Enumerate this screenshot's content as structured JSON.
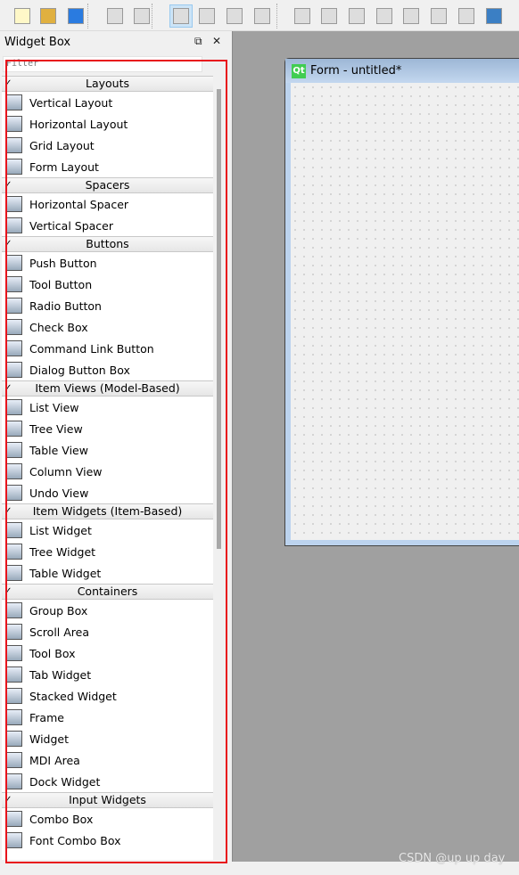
{
  "toolbar": {
    "buttons": [
      "new-file-icon",
      "open-folder-icon",
      "save-icon",
      "send-backward-icon",
      "bring-forward-icon",
      "edit-widgets-icon",
      "edit-signals-slots-icon",
      "edit-buddies-icon",
      "edit-tab-order-icon",
      "layout-horizontal-icon",
      "layout-vertical-icon",
      "splitter-horizontal-icon",
      "splitter-vertical-icon",
      "layout-grid-icon",
      "layout-form-icon",
      "break-layout-icon",
      "adjust-size-icon"
    ]
  },
  "widget_box": {
    "title": "Widget Box",
    "filter_placeholder": "Filter",
    "categories": [
      {
        "label": "Layouts",
        "items": [
          "Vertical Layout",
          "Horizontal Layout",
          "Grid Layout",
          "Form Layout"
        ]
      },
      {
        "label": "Spacers",
        "items": [
          "Horizontal Spacer",
          "Vertical Spacer"
        ]
      },
      {
        "label": "Buttons",
        "items": [
          "Push Button",
          "Tool Button",
          "Radio Button",
          "Check Box",
          "Command Link Button",
          "Dialog Button Box"
        ]
      },
      {
        "label": "Item Views (Model-Based)",
        "items": [
          "List View",
          "Tree View",
          "Table View",
          "Column View",
          "Undo View"
        ]
      },
      {
        "label": "Item Widgets (Item-Based)",
        "items": [
          "List Widget",
          "Tree Widget",
          "Table Widget"
        ]
      },
      {
        "label": "Containers",
        "items": [
          "Group Box",
          "Scroll Area",
          "Tool Box",
          "Tab Widget",
          "Stacked Widget",
          "Frame",
          "Widget",
          "MDI Area",
          "Dock Widget"
        ]
      },
      {
        "label": "Input Widgets",
        "items": [
          "Combo Box",
          "Font Combo Box"
        ]
      }
    ]
  },
  "form": {
    "title": "Form - untitled*",
    "logo": "Qt"
  },
  "watermark": "CSDN @up up day",
  "colors": {
    "highlight": "#e8141c",
    "canvas": "#a0a0a0",
    "qt_green": "#41cd52"
  }
}
